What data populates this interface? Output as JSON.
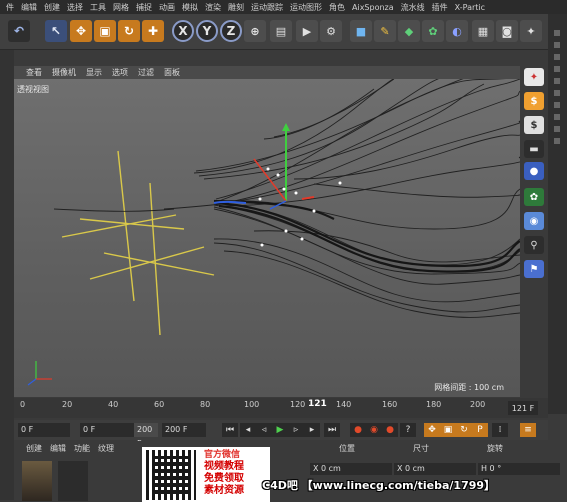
{
  "menu": [
    "件",
    "编辑",
    "创建",
    "选择",
    "工具",
    "网格",
    "捕捉",
    "动画",
    "模拟",
    "渲染",
    "雕刻",
    "运动跟踪",
    "运动图形",
    "角色",
    "AixSponza",
    "流水线",
    "插件",
    "X-Partic"
  ],
  "toolbar": {
    "axis_x": "X",
    "axis_y": "Y",
    "axis_z": "Z"
  },
  "view_menu": [
    "查看",
    "摄像机",
    "显示",
    "选项",
    "过滤",
    "面板"
  ],
  "viewport": {
    "label": "透视视图",
    "grid_spacing": "网格间距 : 100 cm"
  },
  "timeline": {
    "ticks": [
      "0",
      "20",
      "40",
      "60",
      "80",
      "100",
      "120",
      "140",
      "160",
      "180",
      "200"
    ],
    "current_frame": "121",
    "end_label": "121 F"
  },
  "transport": {
    "start_frame": "0 F",
    "min_field": "0 F",
    "max_field": "200 F",
    "end_frame": "200 F"
  },
  "materials_menu": [
    "创建",
    "编辑",
    "功能",
    "纹理"
  ],
  "coordinates": {
    "headers": [
      "位置",
      "尺寸",
      "旋转"
    ],
    "row": [
      "X 0 cm",
      "X 0 cm",
      "H 0 °"
    ]
  },
  "promo": {
    "line1": "官方微信",
    "line2": "视频教程",
    "line3": "免费领取",
    "line4": "素材资源"
  },
  "watermark": "C4D吧 【www.linecg.com/tieba/1799】",
  "colors": {
    "accent_orange": "#c77a1e",
    "accent_blue": "#3b4f7a",
    "spline_yellow": "#d9c84a"
  }
}
